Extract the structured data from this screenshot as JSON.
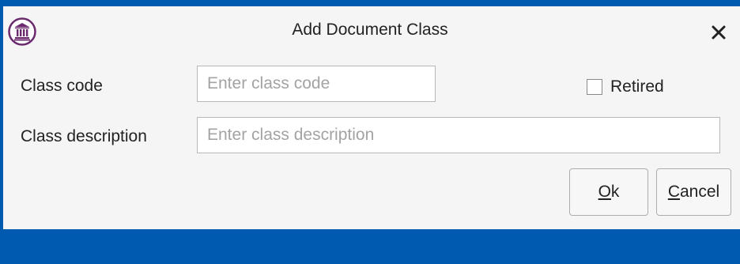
{
  "window": {
    "title": "Add Document Class",
    "app_icon": "institution-building-icon",
    "close_icon": "close-icon",
    "close_glyph": "✕"
  },
  "form": {
    "class_code": {
      "label": "Class code",
      "value": "",
      "placeholder": "Enter class code"
    },
    "retired": {
      "label": "Retired",
      "checked": false
    },
    "class_description": {
      "label": "Class description",
      "value": "",
      "placeholder": "Enter class description"
    }
  },
  "buttons": {
    "ok": {
      "mnemonic": "O",
      "rest": "k"
    },
    "cancel": {
      "mnemonic": "C",
      "rest": "ancel"
    }
  },
  "colors": {
    "accent": "#005bb0",
    "icon": "#6b2a6e",
    "background": "#f5f5f5"
  }
}
